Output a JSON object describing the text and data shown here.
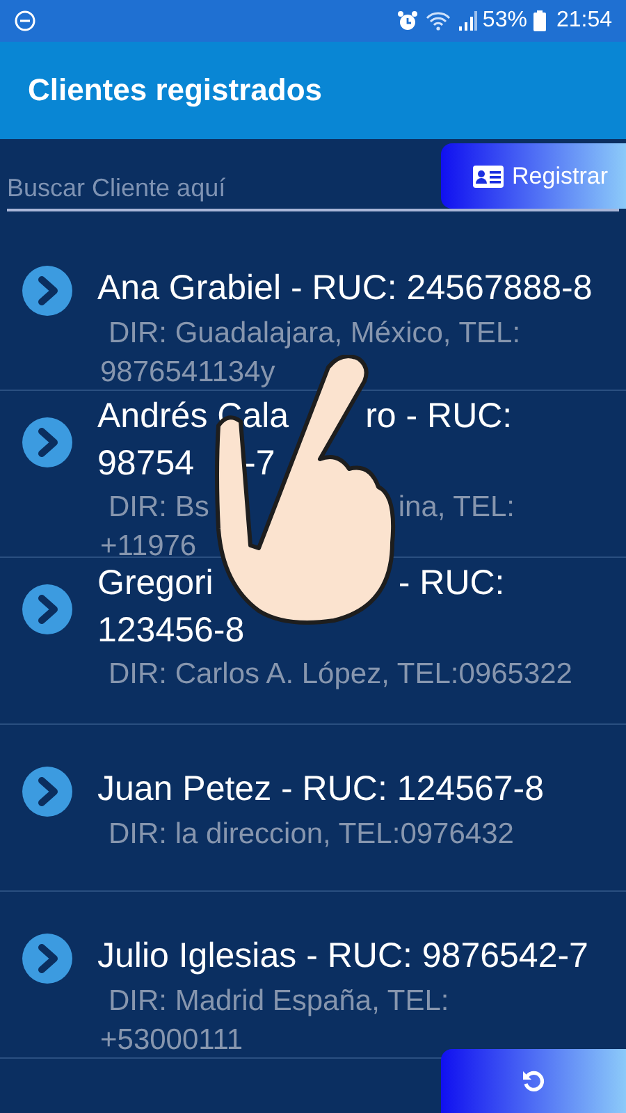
{
  "status_bar": {
    "battery": "53%",
    "time": "21:54"
  },
  "app_bar": {
    "title": "Clientes registrados"
  },
  "search": {
    "placeholder": "Buscar Cliente aquí"
  },
  "register_button": {
    "label": "Registrar"
  },
  "clients": [
    {
      "name_lines": [
        [
          "Ana Grabiel - RUC: 24567888-8"
        ]
      ],
      "address_lines": [
        [
          "DIR: Guadalajara, México, TEL:"
        ],
        [
          "9876541134y"
        ]
      ]
    },
    {
      "name_lines": [
        [
          "Andrés Cala",
          "ro - RUC:"
        ],
        [
          "98754",
          "-7"
        ]
      ],
      "address_lines": [
        [
          "DIR: Bs",
          "ina, TEL:"
        ],
        [
          "+11976"
        ]
      ]
    },
    {
      "name_lines": [
        [
          "Gregori",
          "- RUC:"
        ],
        [
          "123456-8"
        ]
      ],
      "address_lines": [
        [
          "DIR: Carlos A. López, TEL:0965322"
        ]
      ]
    },
    {
      "name_lines": [
        [
          "Juan Petez - RUC: 124567-8"
        ]
      ],
      "address_lines": [
        [
          "DIR: la direccion, TEL:0976432"
        ]
      ]
    },
    {
      "name_lines": [
        [
          "Julio Iglesias - RUC: 9876542-7"
        ]
      ],
      "address_lines": [
        [
          "DIR: Madrid España, TEL:"
        ],
        [
          "+53000111"
        ]
      ]
    }
  ]
}
